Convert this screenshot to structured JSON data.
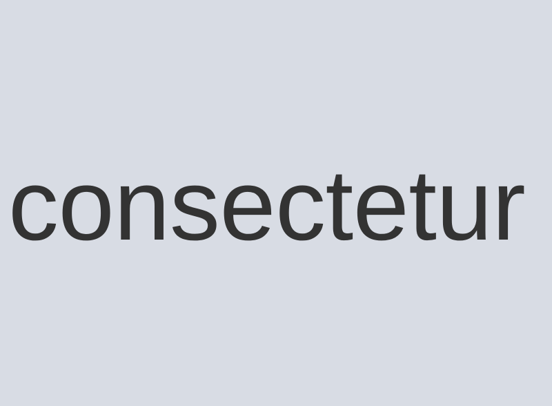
{
  "main": {
    "text": "consectetur"
  },
  "colors": {
    "background": "#d8dce4",
    "text": "#333333"
  }
}
